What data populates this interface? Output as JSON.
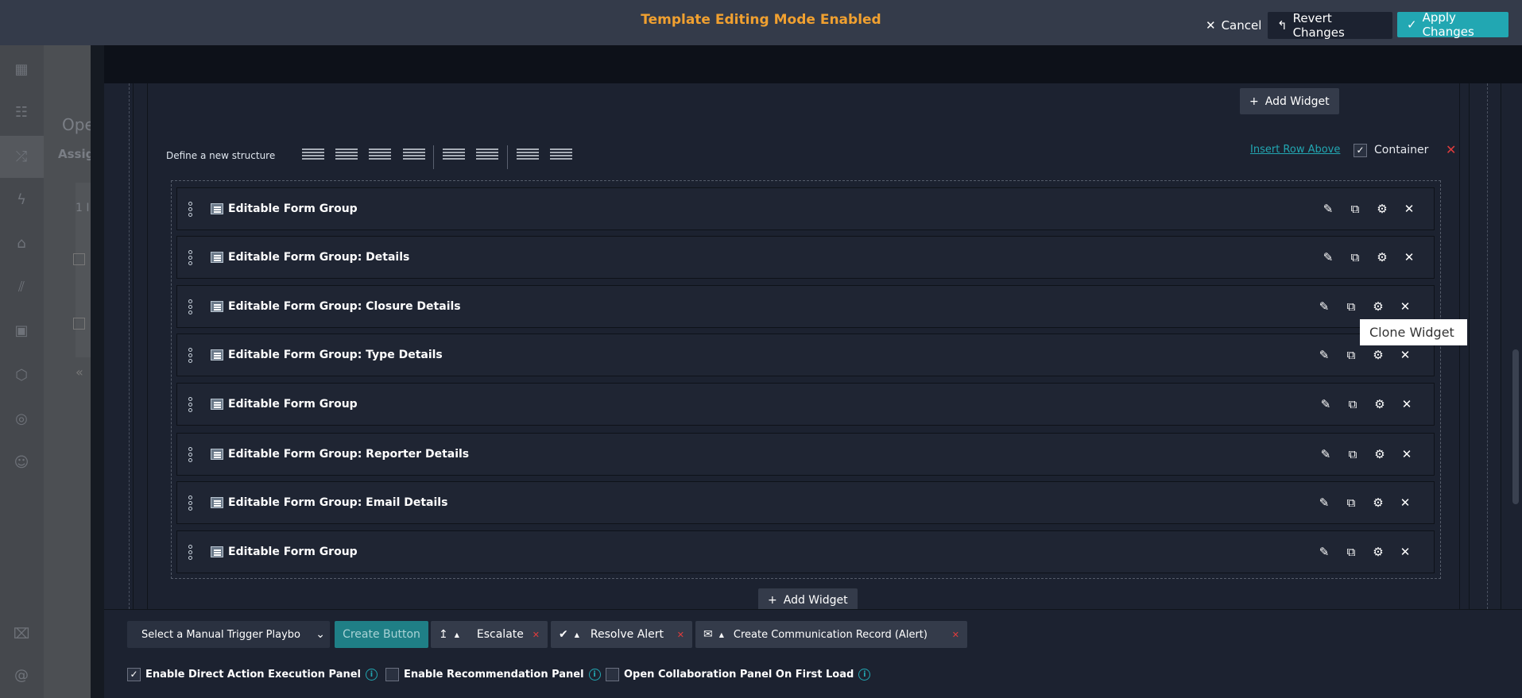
{
  "header": {
    "title": "Template Editing Mode Enabled",
    "cancel": "Cancel",
    "revert": "Revert Changes",
    "apply": "Apply Changes"
  },
  "background_page": {
    "heading": "Ope",
    "tab": "Assig",
    "row": "1 I"
  },
  "sidebar": {
    "icons": [
      "dashboard-icon",
      "team-icon",
      "shuffle-icon",
      "lightning-icon",
      "briefcase-icon",
      "chart-icon",
      "widgets-icon",
      "shield-icon",
      "lifebuoy-icon",
      "users-icon",
      "trash-icon",
      "at-icon"
    ]
  },
  "editor": {
    "add_widget": "Add Widget",
    "define_structure": "Define a new structure",
    "insert_row_above": "Insert Row Above",
    "container_label": "Container",
    "container_checked": true,
    "rows": [
      {
        "label": "Editable Form Group"
      },
      {
        "label": "Editable Form Group: Details"
      },
      {
        "label": "Editable Form Group: Closure Details"
      },
      {
        "label": "Editable Form Group: Type Details"
      },
      {
        "label": "Editable Form Group"
      },
      {
        "label": "Editable Form Group: Reporter Details"
      },
      {
        "label": "Editable Form Group: Email Details"
      },
      {
        "label": "Editable Form Group"
      }
    ],
    "tooltip": "Clone Widget"
  },
  "bottom": {
    "playbook_select": "Select a Manual Trigger Playbo",
    "create_button": "Create Button",
    "actions": [
      {
        "label": "Escalate",
        "icon": "escalate-icon"
      },
      {
        "label": "Resolve Alert",
        "icon": "check-icon"
      },
      {
        "label": "Create Communication Record (Alert)",
        "icon": "mail-icon"
      }
    ],
    "options": [
      {
        "label": "Enable Direct Action Execution Panel",
        "checked": true
      },
      {
        "label": "Enable Recommendation Panel",
        "checked": false
      },
      {
        "label": "Open Collaboration Panel On First Load",
        "checked": false
      }
    ]
  },
  "colors": {
    "accent": "#22a7b2",
    "title": "#f0a030",
    "danger": "#e03c3c"
  }
}
